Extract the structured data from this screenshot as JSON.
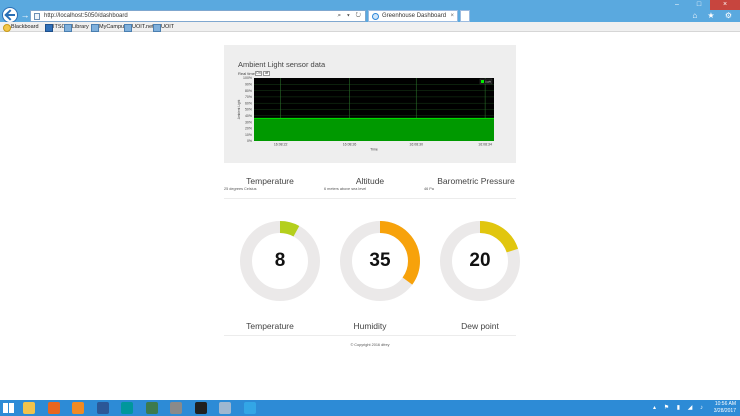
{
  "browser": {
    "address": "http://localhost:5050/dashboard",
    "address_controls": "⌕ ▾ ↻",
    "forward_glyph": "→",
    "tab_title": "Greenhouse Dashboard",
    "tab_close": "×",
    "window_buttons": [
      "–",
      "□",
      "×"
    ],
    "tool_icons": "⌂ ★ ⚙"
  },
  "favorites": [
    "Blackboard",
    "ITSC",
    "Library",
    "MyCampus",
    "UOIT.net",
    "UOIT"
  ],
  "chart_panel": {
    "title": "Ambient Light sensor data",
    "realtime_label": "Real time",
    "realtime_on": "On",
    "realtime_off": "off"
  },
  "chart_data": {
    "type": "area",
    "title": "",
    "xlabel": "Time",
    "ylabel": "Ambient Light",
    "x_ticks": [
      "16:08:22",
      "16:08:26",
      "16:08:30",
      "16:08:34"
    ],
    "y_ticks": [
      "0%",
      "10%",
      "20%",
      "30%",
      "40%",
      "50%",
      "60%",
      "70%",
      "80%",
      "90%",
      "100%"
    ],
    "ylim": [
      0,
      100
    ],
    "series": [
      {
        "name": "Light",
        "values": [
          36,
          36,
          36,
          36,
          36,
          36,
          36,
          36
        ]
      }
    ],
    "legend_position": "top-right",
    "grid": true,
    "colors": {
      "background": "#000000",
      "fill": "#009900",
      "line": "#00ee00",
      "grid": "#1f4f1f"
    }
  },
  "metrics": [
    {
      "title": "Temperature",
      "value": "25 degrees Celsius"
    },
    {
      "title": "Altitude",
      "value": "6 meters above sea level"
    },
    {
      "title": "Barometric Pressure",
      "value": "46 Pa"
    }
  ],
  "gauges": [
    {
      "label": "Temperature",
      "value": "8",
      "fraction": 0.08,
      "color": "#b4cf1c"
    },
    {
      "label": "Humidity",
      "value": "35",
      "fraction": 0.35,
      "color": "#f7a20b"
    },
    {
      "label": "Dew point",
      "value": "20",
      "fraction": 0.2,
      "color": "#e1c60e"
    }
  ],
  "footer": {
    "copyright": "© Copyright 2016 dfrey"
  },
  "taskbar": {
    "apps": [
      {
        "name": "file-explorer",
        "color": "#f1c34b"
      },
      {
        "name": "firefox",
        "color": "#e8661e"
      },
      {
        "name": "app-g",
        "color": "#f08a23"
      },
      {
        "name": "word",
        "color": "#2b5797"
      },
      {
        "name": "arduino",
        "color": "#00979c"
      },
      {
        "name": "network-tool",
        "color": "#3d7a4d"
      },
      {
        "name": "code-editor",
        "color": "#8a8a8a"
      },
      {
        "name": "terminal",
        "color": "#202020"
      },
      {
        "name": "settings",
        "color": "#9fb7d0"
      },
      {
        "name": "internet-explorer",
        "color": "#33a6e6"
      }
    ],
    "tray_icons": "▴ ⚑ ▮ ◢ ♪",
    "time": "10:56 AM",
    "date": "3/28/2017"
  }
}
